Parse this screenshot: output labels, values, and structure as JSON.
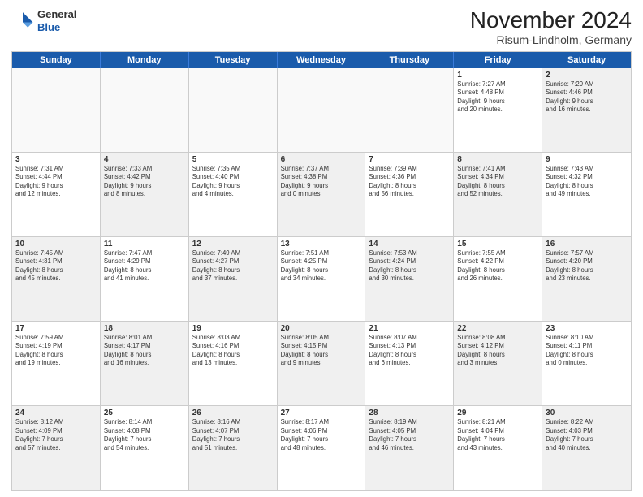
{
  "logo": {
    "general": "General",
    "blue": "Blue"
  },
  "header": {
    "title": "November 2024",
    "subtitle": "Risum-Lindholm, Germany"
  },
  "weekdays": [
    "Sunday",
    "Monday",
    "Tuesday",
    "Wednesday",
    "Thursday",
    "Friday",
    "Saturday"
  ],
  "rows": [
    [
      {
        "day": "",
        "empty": true
      },
      {
        "day": "",
        "empty": true
      },
      {
        "day": "",
        "empty": true
      },
      {
        "day": "",
        "empty": true
      },
      {
        "day": "",
        "empty": true
      },
      {
        "day": "1",
        "info": "Sunrise: 7:27 AM\nSunset: 4:48 PM\nDaylight: 9 hours\nand 20 minutes."
      },
      {
        "day": "2",
        "shaded": true,
        "info": "Sunrise: 7:29 AM\nSunset: 4:46 PM\nDaylight: 9 hours\nand 16 minutes."
      }
    ],
    [
      {
        "day": "3",
        "info": "Sunrise: 7:31 AM\nSunset: 4:44 PM\nDaylight: 9 hours\nand 12 minutes."
      },
      {
        "day": "4",
        "shaded": true,
        "info": "Sunrise: 7:33 AM\nSunset: 4:42 PM\nDaylight: 9 hours\nand 8 minutes."
      },
      {
        "day": "5",
        "info": "Sunrise: 7:35 AM\nSunset: 4:40 PM\nDaylight: 9 hours\nand 4 minutes."
      },
      {
        "day": "6",
        "shaded": true,
        "info": "Sunrise: 7:37 AM\nSunset: 4:38 PM\nDaylight: 9 hours\nand 0 minutes."
      },
      {
        "day": "7",
        "info": "Sunrise: 7:39 AM\nSunset: 4:36 PM\nDaylight: 8 hours\nand 56 minutes."
      },
      {
        "day": "8",
        "shaded": true,
        "info": "Sunrise: 7:41 AM\nSunset: 4:34 PM\nDaylight: 8 hours\nand 52 minutes."
      },
      {
        "day": "9",
        "info": "Sunrise: 7:43 AM\nSunset: 4:32 PM\nDaylight: 8 hours\nand 49 minutes."
      }
    ],
    [
      {
        "day": "10",
        "shaded": true,
        "info": "Sunrise: 7:45 AM\nSunset: 4:31 PM\nDaylight: 8 hours\nand 45 minutes."
      },
      {
        "day": "11",
        "info": "Sunrise: 7:47 AM\nSunset: 4:29 PM\nDaylight: 8 hours\nand 41 minutes."
      },
      {
        "day": "12",
        "shaded": true,
        "info": "Sunrise: 7:49 AM\nSunset: 4:27 PM\nDaylight: 8 hours\nand 37 minutes."
      },
      {
        "day": "13",
        "info": "Sunrise: 7:51 AM\nSunset: 4:25 PM\nDaylight: 8 hours\nand 34 minutes."
      },
      {
        "day": "14",
        "shaded": true,
        "info": "Sunrise: 7:53 AM\nSunset: 4:24 PM\nDaylight: 8 hours\nand 30 minutes."
      },
      {
        "day": "15",
        "info": "Sunrise: 7:55 AM\nSunset: 4:22 PM\nDaylight: 8 hours\nand 26 minutes."
      },
      {
        "day": "16",
        "shaded": true,
        "info": "Sunrise: 7:57 AM\nSunset: 4:20 PM\nDaylight: 8 hours\nand 23 minutes."
      }
    ],
    [
      {
        "day": "17",
        "info": "Sunrise: 7:59 AM\nSunset: 4:19 PM\nDaylight: 8 hours\nand 19 minutes."
      },
      {
        "day": "18",
        "shaded": true,
        "info": "Sunrise: 8:01 AM\nSunset: 4:17 PM\nDaylight: 8 hours\nand 16 minutes."
      },
      {
        "day": "19",
        "info": "Sunrise: 8:03 AM\nSunset: 4:16 PM\nDaylight: 8 hours\nand 13 minutes."
      },
      {
        "day": "20",
        "shaded": true,
        "info": "Sunrise: 8:05 AM\nSunset: 4:15 PM\nDaylight: 8 hours\nand 9 minutes."
      },
      {
        "day": "21",
        "info": "Sunrise: 8:07 AM\nSunset: 4:13 PM\nDaylight: 8 hours\nand 6 minutes."
      },
      {
        "day": "22",
        "shaded": true,
        "info": "Sunrise: 8:08 AM\nSunset: 4:12 PM\nDaylight: 8 hours\nand 3 minutes."
      },
      {
        "day": "23",
        "info": "Sunrise: 8:10 AM\nSunset: 4:11 PM\nDaylight: 8 hours\nand 0 minutes."
      }
    ],
    [
      {
        "day": "24",
        "shaded": true,
        "info": "Sunrise: 8:12 AM\nSunset: 4:09 PM\nDaylight: 7 hours\nand 57 minutes."
      },
      {
        "day": "25",
        "info": "Sunrise: 8:14 AM\nSunset: 4:08 PM\nDaylight: 7 hours\nand 54 minutes."
      },
      {
        "day": "26",
        "shaded": true,
        "info": "Sunrise: 8:16 AM\nSunset: 4:07 PM\nDaylight: 7 hours\nand 51 minutes."
      },
      {
        "day": "27",
        "info": "Sunrise: 8:17 AM\nSunset: 4:06 PM\nDaylight: 7 hours\nand 48 minutes."
      },
      {
        "day": "28",
        "shaded": true,
        "info": "Sunrise: 8:19 AM\nSunset: 4:05 PM\nDaylight: 7 hours\nand 46 minutes."
      },
      {
        "day": "29",
        "info": "Sunrise: 8:21 AM\nSunset: 4:04 PM\nDaylight: 7 hours\nand 43 minutes."
      },
      {
        "day": "30",
        "shaded": true,
        "info": "Sunrise: 8:22 AM\nSunset: 4:03 PM\nDaylight: 7 hours\nand 40 minutes."
      }
    ]
  ]
}
